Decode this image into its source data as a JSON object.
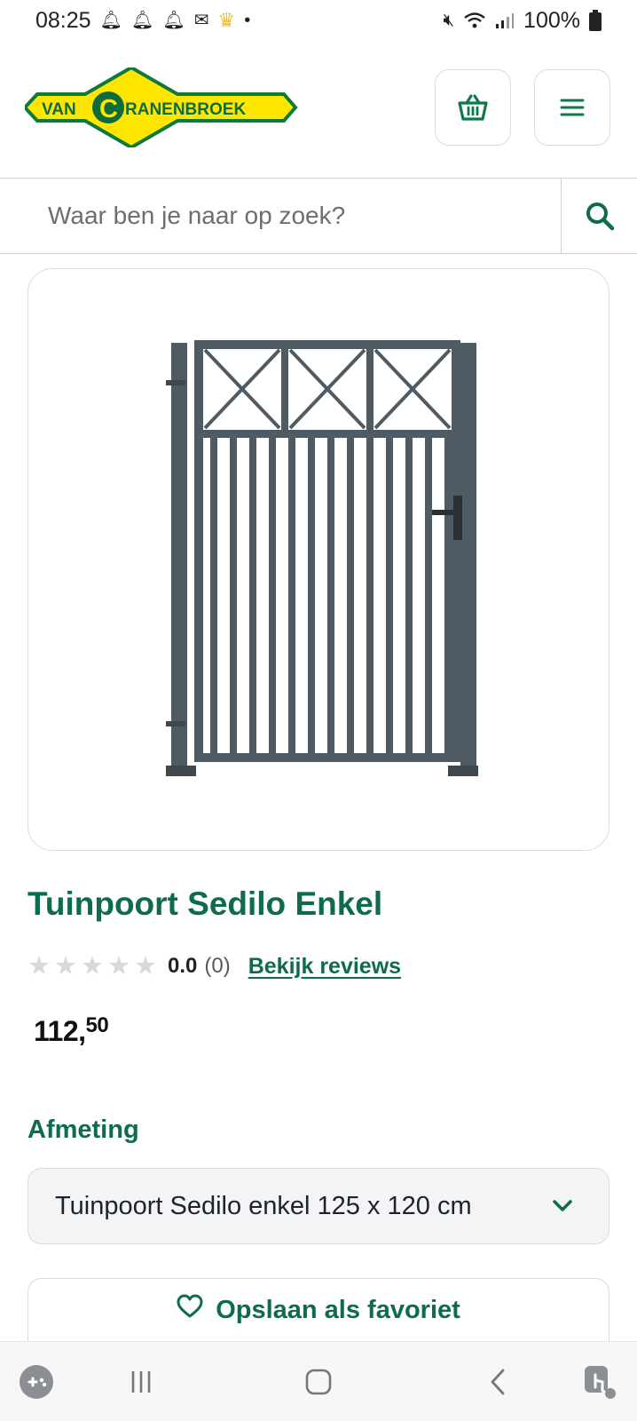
{
  "status_bar": {
    "time": "08:25",
    "battery": "100%"
  },
  "header": {
    "logo_text": "VANCRANENBROEK",
    "logo_prefix": "VAN",
    "logo_initial": "C",
    "logo_rest": "RANENBROEK"
  },
  "search": {
    "placeholder": "Waar ben je naar op zoek?"
  },
  "product": {
    "title": "Tuinpoort Sedilo Enkel",
    "rating_value": "0.0",
    "rating_count": "(0)",
    "rating_stars": 0,
    "reviews_link": "Bekijk reviews",
    "price_whole": "112,",
    "price_cents": "50"
  },
  "options": {
    "label": "Afmeting",
    "selected": "Tuinpoort Sedilo enkel 125 x 120 cm"
  },
  "actions": {
    "favorite_label": "Opslaan als favoriet"
  },
  "colors": {
    "brand_green": "#0e6b4b",
    "logo_yellow": "#ffe600",
    "gate_gray": "#4f5b62"
  }
}
